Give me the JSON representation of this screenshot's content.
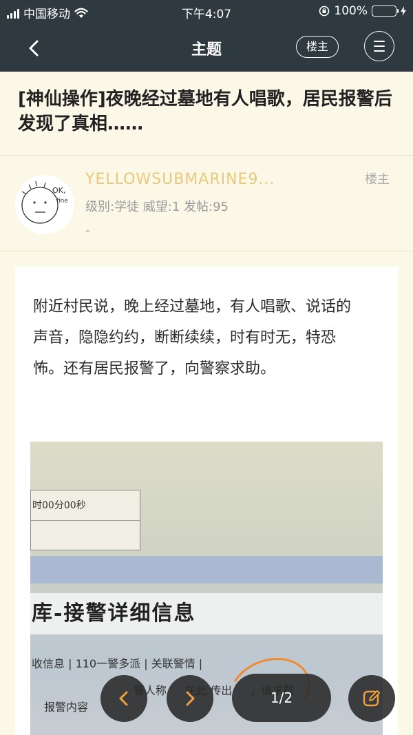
{
  "status_bar": {
    "carrier": "中国移动",
    "time": "下午4:07",
    "battery_percent": "100%",
    "battery_level": 1.0,
    "battery_color": "#4cd964"
  },
  "nav": {
    "title": "主题",
    "op_label": "楼主",
    "icons": [
      "chevron-left-icon",
      "menu-icon"
    ]
  },
  "thread": {
    "title": "[神仙操作]夜晚经过墓地有人唱歌，居民报警后发现了真相……"
  },
  "author": {
    "name": "YELLOWSUBMARINE9...",
    "meta": "级别:学徒  威望:1  发帖:95",
    "extra": "-",
    "tag": "楼主",
    "avatar_text_1": "OK,",
    "avatar_text_2": "fine"
  },
  "post": {
    "text": "附近村民说，晚上经过墓地，有人唱歌、说话的声音，隐隐约约，断断续续，时有时无，特恐怖。还有居民报警了，向警察求助。",
    "photo": {
      "cell_text": "时00分00秒",
      "header": "库-接警详细信息",
      "tabs": "收信息 | 110一警多派 | 关联警情 |",
      "label": "报警内容",
      "content": "警人称 　 在此 传出 　 ，请求帮"
    }
  },
  "controls": {
    "page_indicator": "1/2",
    "icons": [
      "chevron-left-icon",
      "chevron-right-icon",
      "edit-icon"
    ],
    "accent": "#f0a040"
  }
}
